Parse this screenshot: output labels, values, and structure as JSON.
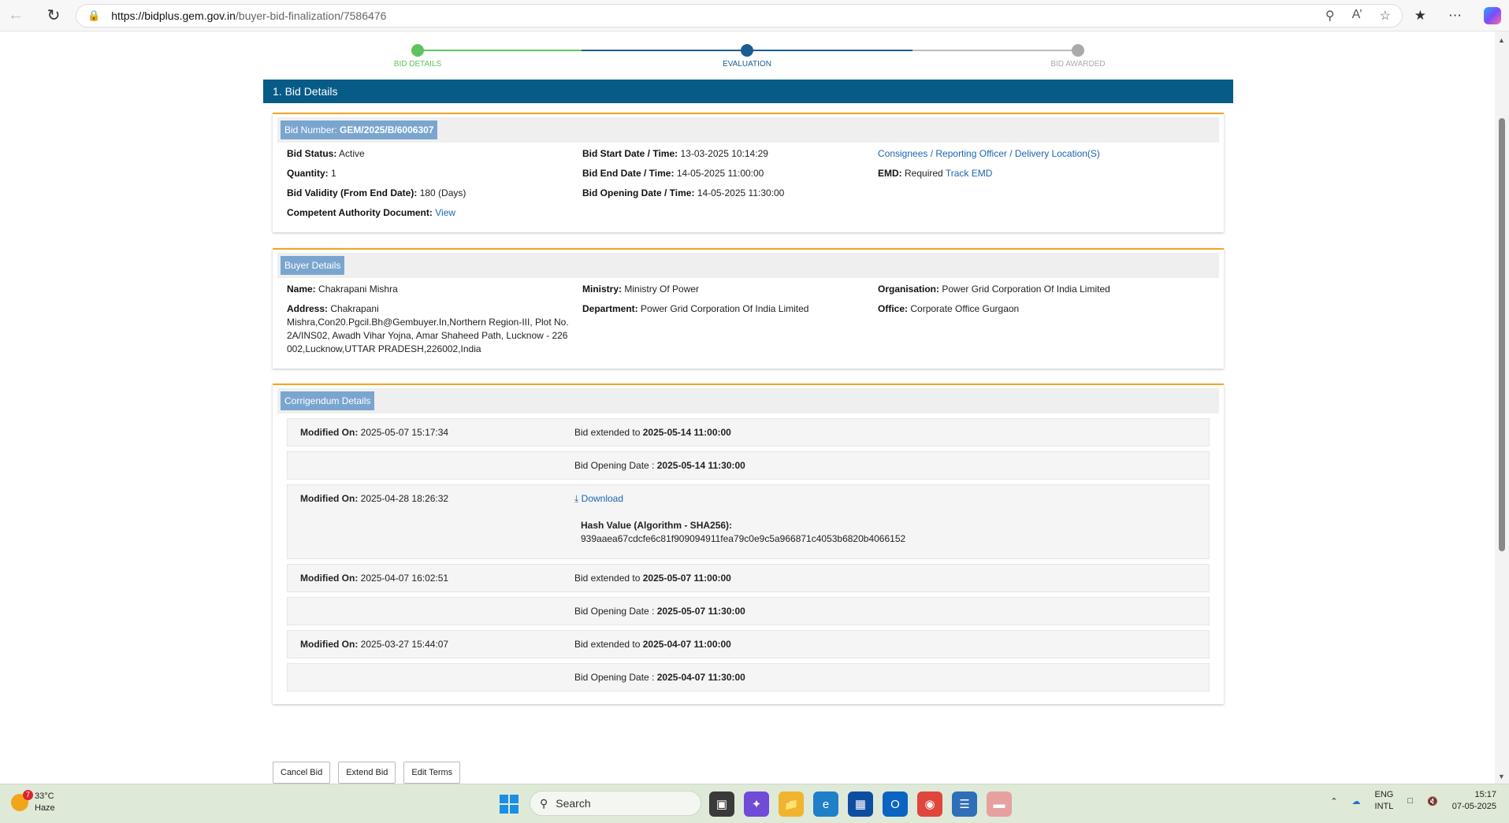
{
  "browser": {
    "url_host": "https://bidplus.gem.gov.in",
    "url_path": "/buyer-bid-finalization/7586476"
  },
  "stepper": {
    "steps": [
      "BID DETAILS",
      "EVALUATION",
      "BID AWARDED"
    ],
    "active_step": 2
  },
  "section_title": "1. Bid Details",
  "bid": {
    "number_label": "Bid Number:",
    "number_value": "GEM/2025/B/6006307",
    "status_label": "Bid Status:",
    "status_value": "Active",
    "quantity_label": "Quantity:",
    "quantity_value": "1",
    "validity_label": "Bid Validity (From End Date):",
    "validity_value": "180 (Days)",
    "authority_label": "Competent Authority Document:",
    "authority_link": "View",
    "start_label": "Bid Start Date / Time:",
    "start_value": "13-03-2025 10:14:29",
    "end_label": "Bid End Date / Time:",
    "end_value": "14-05-2025 11:00:00",
    "opening_label": "Bid Opening Date / Time:",
    "opening_value": "14-05-2025 11:30:00",
    "consignees_link": "Consignees / Reporting Officer / Delivery Location(S)",
    "emd_label": "EMD:",
    "emd_value": "Required",
    "emd_link": "Track EMD"
  },
  "buyer": {
    "title": "Buyer Details",
    "name_label": "Name:",
    "name_value": "Chakrapani Mishra",
    "address_label": "Address:",
    "address_value": "Chakrapani Mishra,Con20.Pgcil.Bh@Gembuyer.In,Northern Region-III, Plot No. 2A/INS02, Awadh Vihar Yojna, Amar Shaheed Path, Lucknow - 226 002,Lucknow,UTTAR PRADESH,226002,India",
    "ministry_label": "Ministry:",
    "ministry_value": "Ministry Of Power",
    "department_label": "Department:",
    "department_value": "Power Grid Corporation Of India Limited",
    "organisation_label": "Organisation:",
    "organisation_value": "Power Grid Corporation Of India Limited",
    "office_label": "Office:",
    "office_value": "Corporate Office Gurgaon"
  },
  "corrigendum": {
    "title": "Corrigendum Details",
    "modified_label": "Modified On:",
    "extended_prefix": "Bid extended to",
    "opening_prefix": "Bid Opening Date :",
    "download_label": "Download",
    "hash_label": "Hash Value (Algorithm - SHA256):",
    "rows": [
      {
        "modified": "2025-05-07 15:17:34",
        "extended": "2025-05-14 11:00:00",
        "opening": "2025-05-14 11:30:00"
      },
      {
        "modified": "2025-04-28 18:26:32",
        "hash": "939aaea67cdcfe6c81f909094911fea79c0e9c5a966871c4053b6820b4066152"
      },
      {
        "modified": "2025-04-07 16:02:51",
        "extended": "2025-05-07 11:00:00",
        "opening": "2025-05-07 11:30:00"
      },
      {
        "modified": "2025-03-27 15:44:07",
        "extended": "2025-04-07 11:00:00",
        "opening": "2025-04-07 11:30:00"
      }
    ]
  },
  "actions": {
    "cancel": "Cancel Bid",
    "extend": "Extend Bid",
    "edit_terms": "Edit Terms"
  },
  "taskbar": {
    "weather_temp": "33°C",
    "weather_desc": "Haze",
    "weather_badge": "7",
    "search_placeholder": "Search",
    "lang_top": "ENG",
    "lang_bottom": "INTL",
    "time": "15:17",
    "date": "07-05-2025"
  },
  "colors": {
    "header_blue": "#075b87",
    "step_done": "#5ec35e",
    "step_active": "#1a5d92",
    "card_accent": "#f5a623",
    "link": "#1b66b0"
  }
}
